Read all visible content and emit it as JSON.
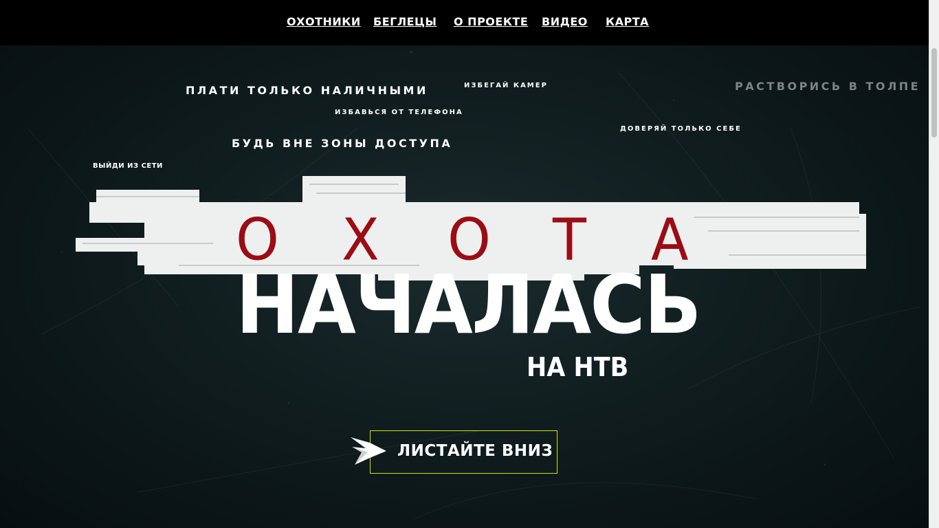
{
  "nav": {
    "items": [
      "ОХОТНИКИ",
      "БЕГЛЕЦЫ",
      "О ПРОЕКТЕ",
      "ВИДЕО",
      "КАРТА"
    ]
  },
  "hero": {
    "tags": [
      "ПЛАТИ ТОЛЬКО НАЛИЧНЫМИ",
      "ИЗБЕГАЙ КАМЕР",
      "РАСТВОРИСЬ В ТОЛПЕ",
      "ИЗБАВЬСЯ ОТ ТЕЛЕФОНА",
      "ДОВЕРЯЙ ТОЛЬКО СЕБЕ",
      "БУДЬ ВНЕ ЗОНЫ ДОСТУПА",
      "ВЫЙДИ ИЗ СЕТИ"
    ],
    "okhota_letters": [
      "О",
      "Х",
      "О",
      "Т",
      "А"
    ],
    "title": "НАЧАЛАСЬ",
    "subtitle": "НА НТВ",
    "cta_label": "ЛИСТАЙТЕ ВНИЗ"
  },
  "colors": {
    "accent_red": "#9b0c14",
    "cta_border": "#d8e400",
    "background": "#0b1416"
  },
  "icons": {
    "arrow": "arrow-right-icon"
  }
}
